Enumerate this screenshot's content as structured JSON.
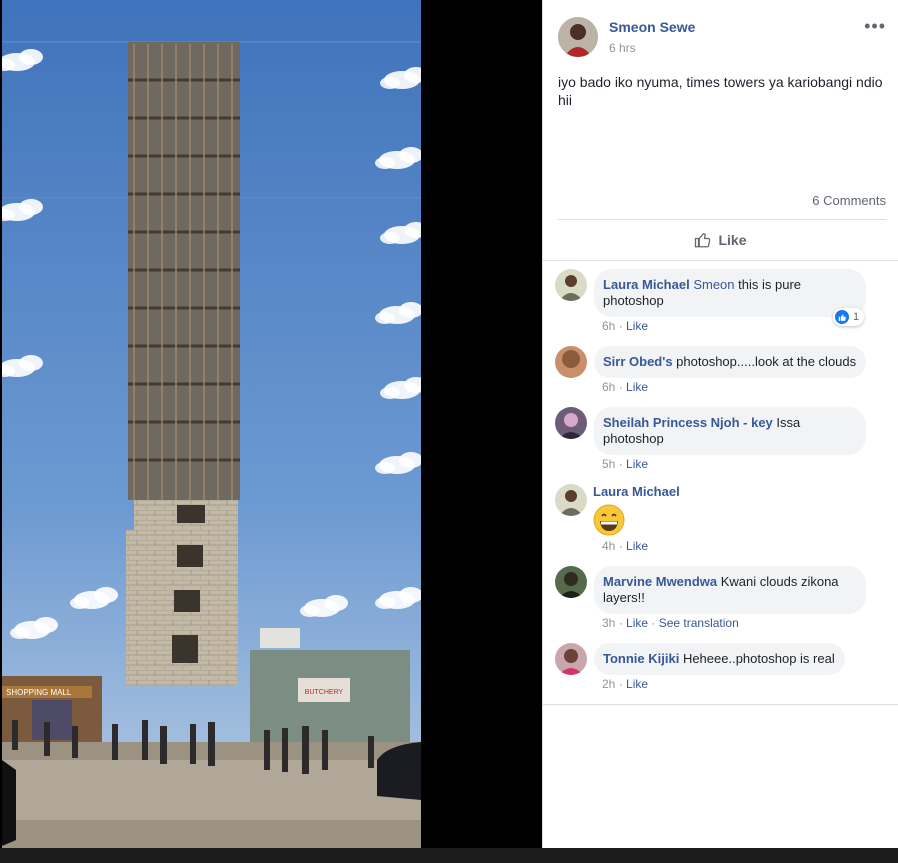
{
  "post": {
    "author": "Smeon Sewe",
    "time": "6 hrs",
    "more_label": "•••",
    "text": "iyo bado iko nyuma, times towers ya kariobangi ndio hii",
    "comments_count": "6 Comments",
    "like_label": "Like",
    "photo_sign_left": "SHOPPING MALL",
    "photo_sign_right": "BUTCHERY"
  },
  "comments": [
    {
      "name": "Laura Michael",
      "mention": "Smeon",
      "text": " this is pure photoshop",
      "time": "6h",
      "like": "Like",
      "reactions": "1"
    },
    {
      "name": "Sirr Obed's",
      "text": " photoshop.....look at the clouds",
      "time": "6h",
      "like": "Like"
    },
    {
      "name": "Sheilah Princess Njoh - key",
      "text": " Issa photoshop",
      "time": "5h",
      "like": "Like"
    },
    {
      "name": "Laura Michael",
      "emoji": "grinning-face",
      "time": "4h",
      "like": "Like"
    },
    {
      "name": "Marvine Mwendwa",
      "text": " Kwani clouds zikona layers!!",
      "time": "3h",
      "like": "Like",
      "translate": "See translation"
    },
    {
      "name": "Tonnie Kijiki",
      "text": " Heheee..photoshop is real",
      "time": "2h",
      "like": "Like"
    }
  ],
  "meta_separator": " · ",
  "colors": {
    "link": "#385898",
    "bubble": "#f2f3f5",
    "sky": "#4a7ec2",
    "muted": "#90949c"
  }
}
